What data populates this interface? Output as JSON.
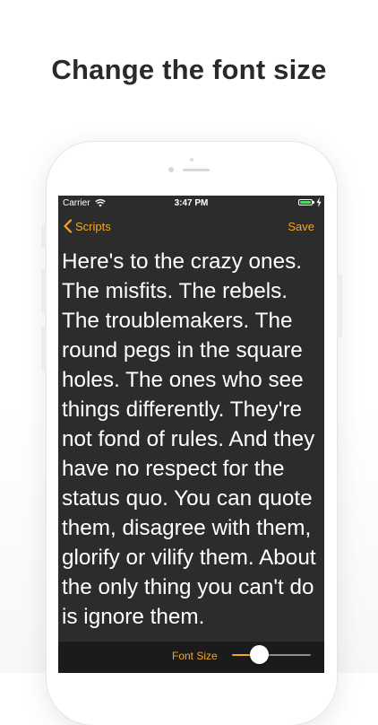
{
  "headline": "Change the font size",
  "status_bar": {
    "carrier": "Carrier",
    "time": "3:47 PM",
    "wifi_icon": "wifi-icon",
    "battery_icon": "battery-icon"
  },
  "nav": {
    "back_label": "Scripts",
    "save_label": "Save",
    "accent_color": "#f5a623"
  },
  "script": {
    "text": "Here's to the crazy ones. The misfits. The rebels. The troublemakers. The round pegs in the square holes. The ones who see things differently. They're not fond of rules. And they have no respect for the status quo. You can quote them, disagree with them, glorify or vilify them. About the only thing you can't do is ignore them."
  },
  "toolbar": {
    "font_size_label": "Font Size",
    "font_size_slider_fraction": 0.3
  },
  "colors": {
    "screen_background": "#2c2c2c",
    "toolbar_background": "#1b1b1b",
    "text": "#ffffff"
  }
}
